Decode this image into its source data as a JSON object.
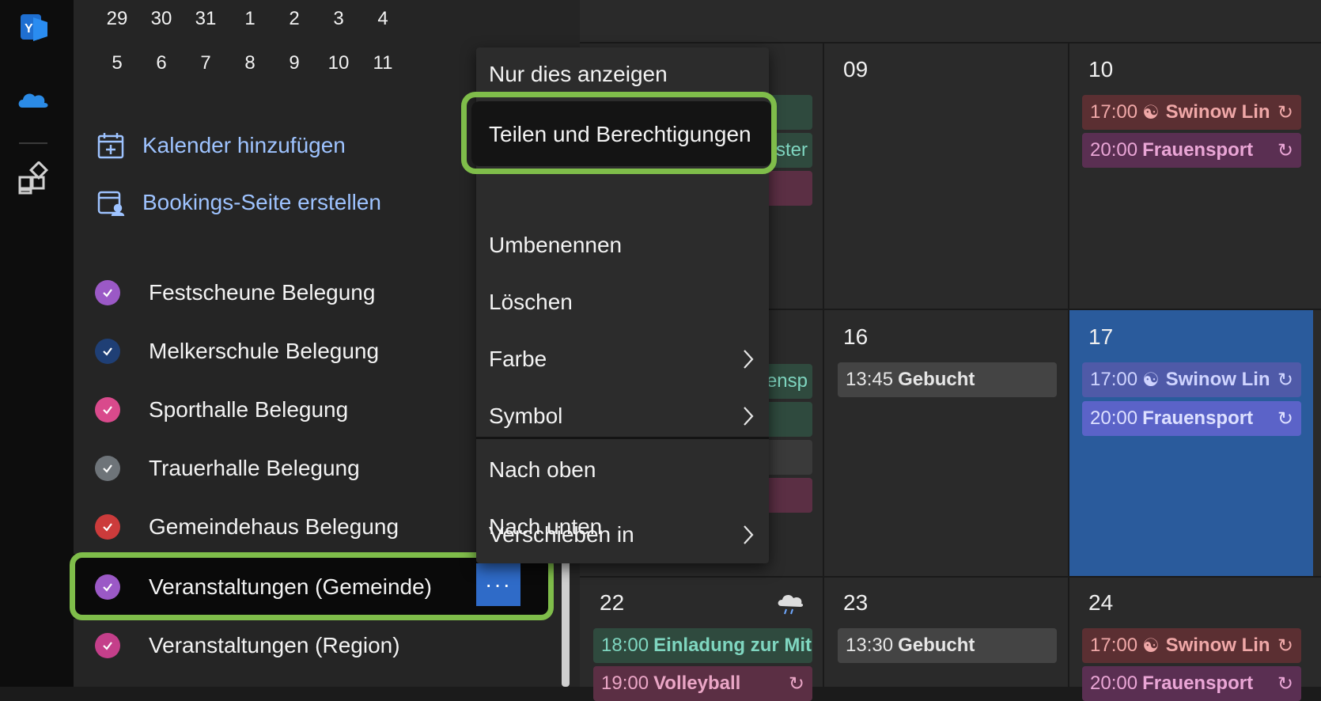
{
  "mini_calendar": {
    "week1": [
      "29",
      "30",
      "31",
      "1",
      "2",
      "3",
      "4"
    ],
    "week2": [
      "5",
      "6",
      "7",
      "8",
      "9",
      "10",
      "11"
    ]
  },
  "sidebar": {
    "add_calendar": "Kalender hinzufügen",
    "bookings": "Bookings-Seite erstellen",
    "calendars": [
      {
        "label": "Festscheune Belegung",
        "color": "#9b59c6"
      },
      {
        "label": "Melkerschule Belegung",
        "color": "#1f3f75"
      },
      {
        "label": "Sporthalle Belegung",
        "color": "#d94a8c"
      },
      {
        "label": "Trauerhalle Belegung",
        "color": "#6e7479"
      },
      {
        "label": "Gemeindehaus Belegung",
        "color": "#cc3b3b"
      },
      {
        "label": "Veranstaltungen (Gemeinde)",
        "color": "#9b59c6"
      },
      {
        "label": "Veranstaltungen (Region)",
        "color": "#c43f8a"
      }
    ],
    "more_label": "···"
  },
  "context_menu": {
    "items": [
      "Nur dies anzeigen",
      "Teilen und Berechtigungen",
      "Umbenennen",
      "Löschen",
      "Farbe",
      "Symbol",
      "Nach oben",
      "Nach unten",
      "Verschieben in"
    ]
  },
  "calendar_grid": {
    "days": {
      "d09": "09",
      "d10": "10",
      "d16": "16",
      "d17": "17",
      "d22": "22",
      "d23": "23",
      "d24": "24"
    },
    "events": {
      "e10a_time": "17:00",
      "e10a_title": "Swinow Lin",
      "e10b_time": "20:00",
      "e10b_title": "Frauensport",
      "e16_time": "13:45",
      "e16_title": "Gebucht",
      "e17a_time": "17:00",
      "e17a_title": "Swinow Lin",
      "e17b_time": "20:00",
      "e17b_title": "Frauensport",
      "e22a_time": "18:00",
      "e22a_title": "Einladung zur Mitg",
      "e22b_time": "19:00",
      "e22b_title": "Volleyball",
      "e23_time": "13:30",
      "e23_title": "Gebucht",
      "e24a_time": "17:00",
      "e24a_title": "Swinow Lin",
      "e24b_time": "20:00",
      "e24b_title": "Frauensport",
      "frag_a": "ster",
      "frag_b": "ensp"
    }
  },
  "colors": {
    "accent": "#2f6bc8",
    "highlight": "#7fbd4a",
    "today": "#2a5b9c"
  }
}
